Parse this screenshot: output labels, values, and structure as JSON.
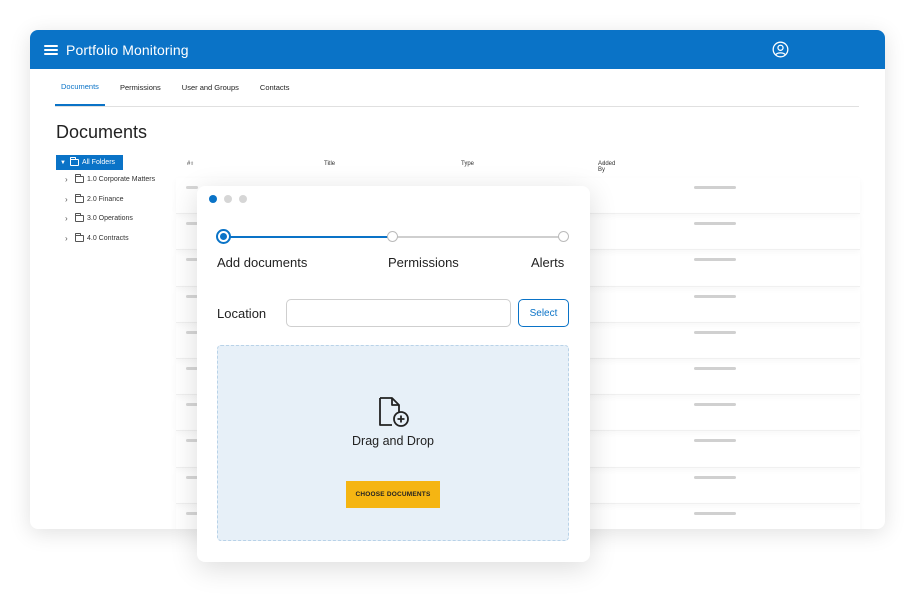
{
  "app": {
    "title": "Portfolio Monitoring",
    "accent": "#0a73c7",
    "menu_icon": "hamburger-icon",
    "user_icon": "user-circle-icon"
  },
  "tabs": [
    {
      "label": "Documents",
      "active": true
    },
    {
      "label": "Permissions",
      "active": false
    },
    {
      "label": "User and Groups",
      "active": false
    },
    {
      "label": "Contacts",
      "active": false
    }
  ],
  "page": {
    "title": "Documents"
  },
  "tree": {
    "root": "All Folders",
    "items": [
      "1.0 Corporate Matters",
      "2.0 Finance",
      "3.0 Operations",
      "4.0 Contracts"
    ]
  },
  "table": {
    "columns": [
      "#",
      "Title",
      "Type",
      "Added By"
    ],
    "sort_glyph": "⬍"
  },
  "modal": {
    "steps": [
      "Add documents",
      "Permissions",
      "Alerts"
    ],
    "active_step": 1,
    "location_label": "Location",
    "location_value": "",
    "select_label": "Select",
    "dropzone_text": "Drag and Drop",
    "choose_label": "CHOOSE DOCUMENTS",
    "file_icon": "file-add-icon",
    "button_color": "#f5b512",
    "dropzone_color": "#e7f0f8"
  }
}
